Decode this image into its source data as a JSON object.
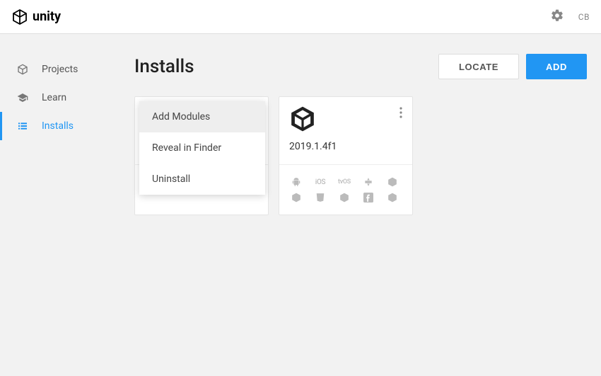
{
  "header": {
    "brand": "unity",
    "user_initials": "CB"
  },
  "sidebar": {
    "items": [
      {
        "label": "Projects"
      },
      {
        "label": "Learn"
      },
      {
        "label": "Installs"
      }
    ]
  },
  "page": {
    "title": "Installs",
    "locate_label": "LOCATE",
    "add_label": "ADD"
  },
  "context_menu": {
    "add_modules": "Add Modules",
    "reveal_in_finder": "Reveal in Finder",
    "uninstall": "Uninstall"
  },
  "installs": [
    {
      "version": "2019.1.4f1"
    }
  ],
  "platform_icons": {
    "android": "android",
    "ios": "iOS",
    "tvos": "tvOS",
    "tizen": "tizen",
    "unity1": "unity",
    "unity2": "unity",
    "html5": "html5",
    "unity3": "unity",
    "facebook": "facebook",
    "unity4": "unity"
  }
}
